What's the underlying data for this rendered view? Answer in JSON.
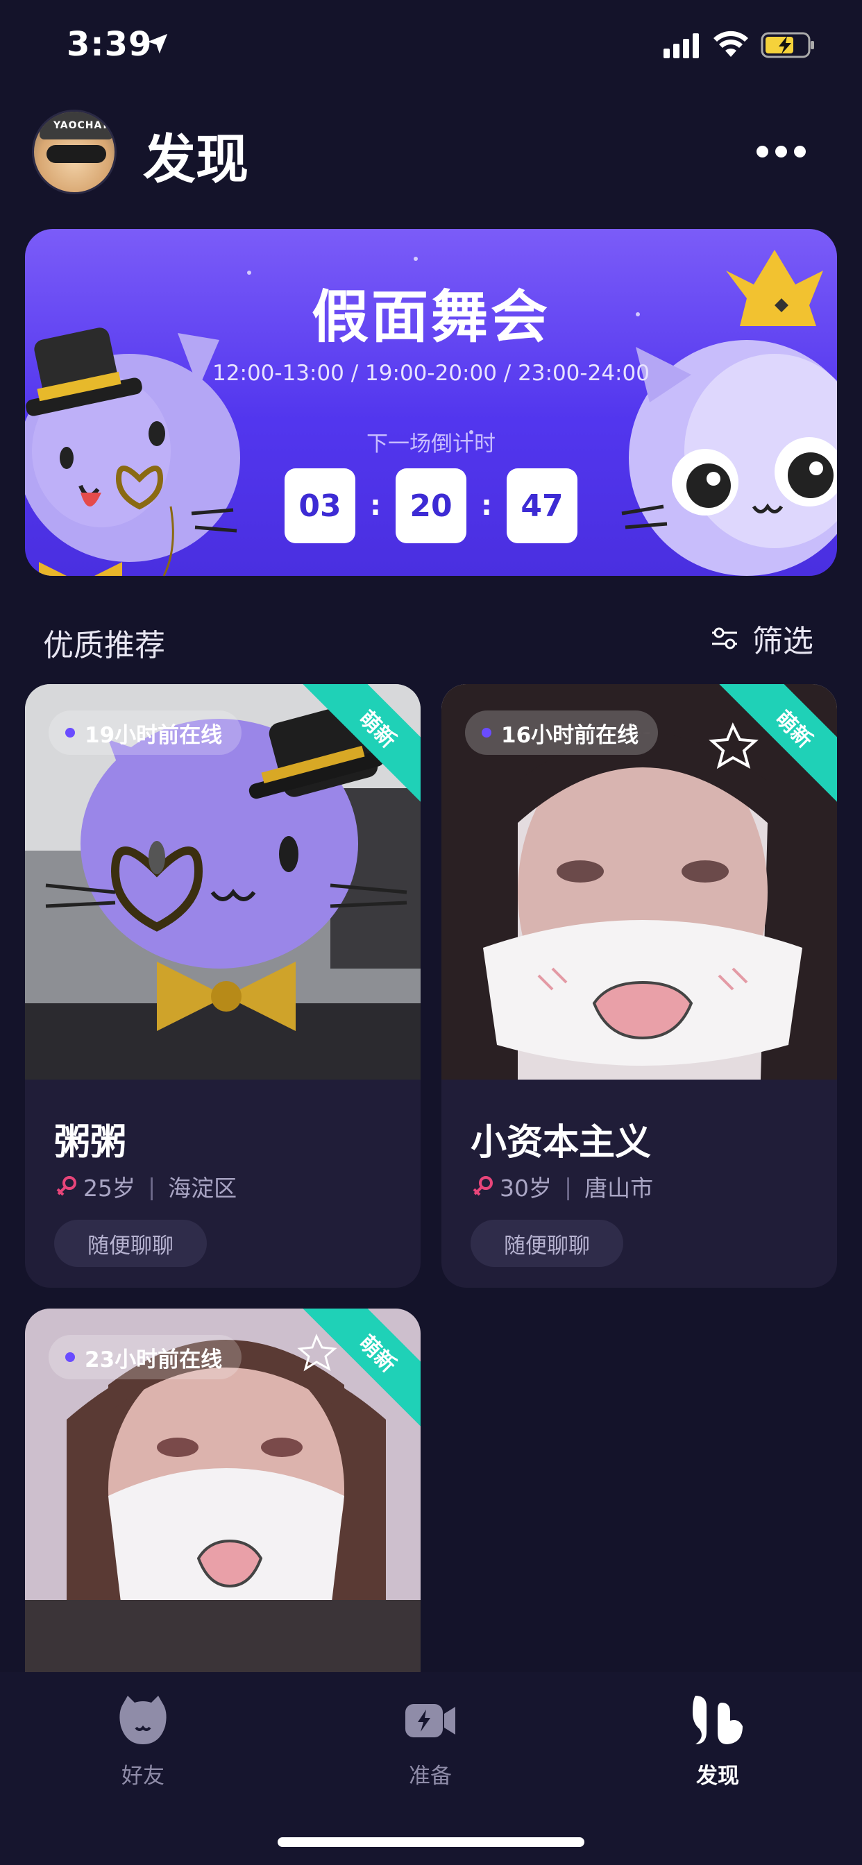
{
  "status_bar": {
    "time": "3:39",
    "icons": [
      "location-arrow-icon",
      "cellular-signal-icon",
      "wifi-icon",
      "battery-charging-icon"
    ]
  },
  "header": {
    "avatar_badge_text": "YAOCHAT",
    "title": "发现",
    "more_icon": "more-dots-icon"
  },
  "banner": {
    "title": "假面舞会",
    "time_slots": "12:00-13:00 / 19:00-20:00 / 23:00-24:00",
    "countdown_label": "下一场倒计时",
    "countdown": {
      "hours": "03",
      "minutes": "20",
      "seconds": "47",
      "separator": ":"
    },
    "colors": {
      "gradient_top": "#7b5cf8",
      "gradient_bottom": "#4a2fe0"
    }
  },
  "section": {
    "title": "优质推荐",
    "filter_label": "筛选",
    "filter_icon": "sliders-icon"
  },
  "cards": [
    {
      "online": "19小时前在线",
      "badge": "萌新",
      "name": "粥粥",
      "age": "25岁",
      "location": "海淀区",
      "chat_label": "随便聊聊",
      "gender_icon": "female-icon"
    },
    {
      "online": "16小时前在线",
      "badge": "萌新",
      "name": "小资本主义",
      "age": "30岁",
      "location": "唐山市",
      "chat_label": "随便聊聊",
      "gender_icon": "female-icon"
    },
    {
      "online": "23小时前在线",
      "badge": "萌新",
      "name": "",
      "age": "",
      "location": "",
      "chat_label": "",
      "gender_icon": "female-icon"
    }
  ],
  "info_separator": "|",
  "tabs": [
    {
      "label": "好友",
      "icon": "friends-cat-icon",
      "active": false
    },
    {
      "label": "准备",
      "icon": "video-camera-icon",
      "active": false
    },
    {
      "label": "发现",
      "icon": "discover-quote-icon",
      "active": true
    }
  ],
  "colors": {
    "background": "#14132a",
    "card_background": "#201d38",
    "accent_purple": "#6a4cff",
    "new_badge": "#1fd1b7",
    "female_pink": "#e8457a"
  }
}
